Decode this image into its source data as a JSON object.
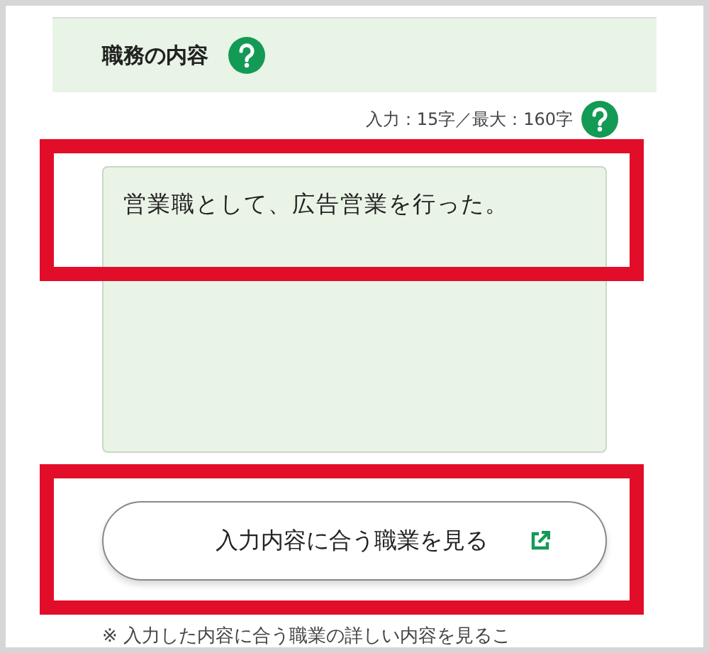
{
  "section": {
    "title": "職務の内容"
  },
  "counter": "入力：15字／最大：160字",
  "textarea": {
    "value": "営業職として、広告営業を行った。",
    "highlighted": true
  },
  "button": {
    "label": "入力内容に合う職業を見る",
    "highlighted": true
  },
  "note": "※ 入力した内容に合う職業の詳しい内容を見るこ"
}
